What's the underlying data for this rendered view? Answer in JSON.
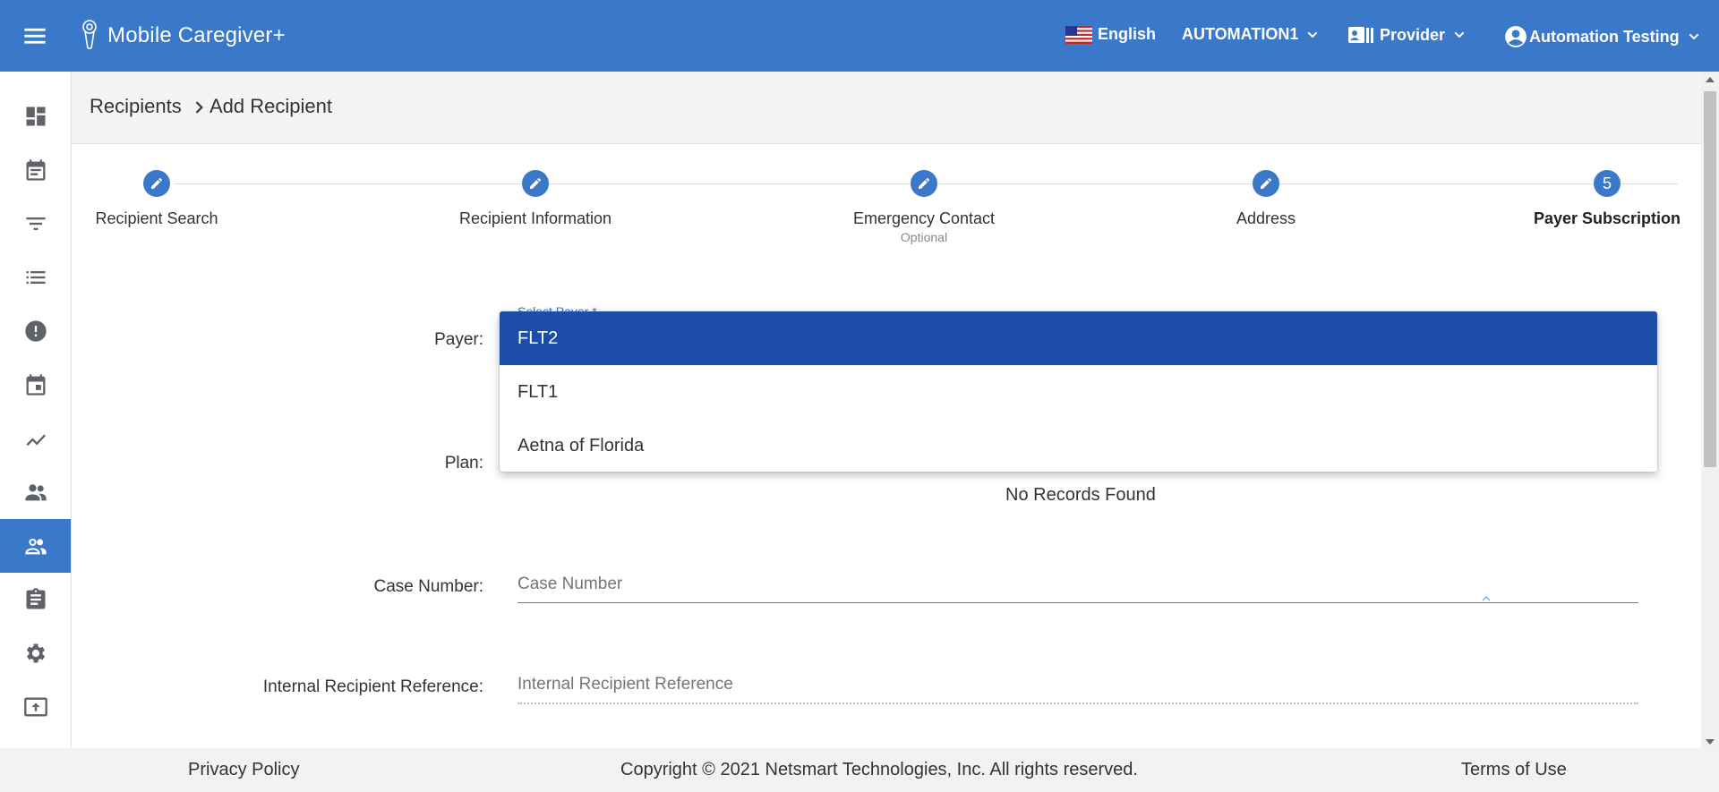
{
  "header": {
    "app_title": "Mobile Caregiver+",
    "language": "English",
    "organization": "AUTOMATION1",
    "role": "Provider",
    "user": "Automation Testing",
    "bg_color": "#3a78c9"
  },
  "sidebar": {
    "items": [
      {
        "icon": "dashboard-icon"
      },
      {
        "icon": "calendar-event-icon"
      },
      {
        "icon": "filter-list-icon"
      },
      {
        "icon": "list-icon"
      },
      {
        "icon": "alert-icon"
      },
      {
        "icon": "calendar-icon"
      },
      {
        "icon": "trend-icon"
      },
      {
        "icon": "people-icon"
      },
      {
        "icon": "recipients-icon",
        "active": true
      },
      {
        "icon": "clipboard-icon"
      },
      {
        "icon": "gear-icon"
      },
      {
        "icon": "upload-icon"
      }
    ]
  },
  "breadcrumb": {
    "parent": "Recipients",
    "current": "Add Recipient"
  },
  "stepper": {
    "steps": [
      {
        "label": "Recipient Search",
        "state": "edit"
      },
      {
        "label": "Recipient Information",
        "state": "edit"
      },
      {
        "label": "Emergency Contact",
        "sublabel": "Optional",
        "state": "edit"
      },
      {
        "label": "Address",
        "state": "edit"
      },
      {
        "label": "Payer Subscription",
        "number": "5",
        "state": "active"
      }
    ]
  },
  "form": {
    "payer_label": "Payer:",
    "payer_hint": "Select Payer *",
    "plan_label": "Plan:",
    "no_records": "No Records Found",
    "case_label": "Case Number:",
    "case_placeholder": "Case Number",
    "internal_label": "Internal Recipient Reference:",
    "internal_placeholder": "Internal Recipient Reference"
  },
  "payer_dropdown": {
    "options": [
      "FLT2",
      "FLT1",
      "Aetna of Florida"
    ],
    "selected": "FLT2",
    "selected_color": "#1c4da8"
  },
  "footer": {
    "privacy": "Privacy Policy",
    "copyright": "Copyright © 2021 Netsmart Technologies, Inc. All rights reserved.",
    "terms": "Terms of Use"
  }
}
